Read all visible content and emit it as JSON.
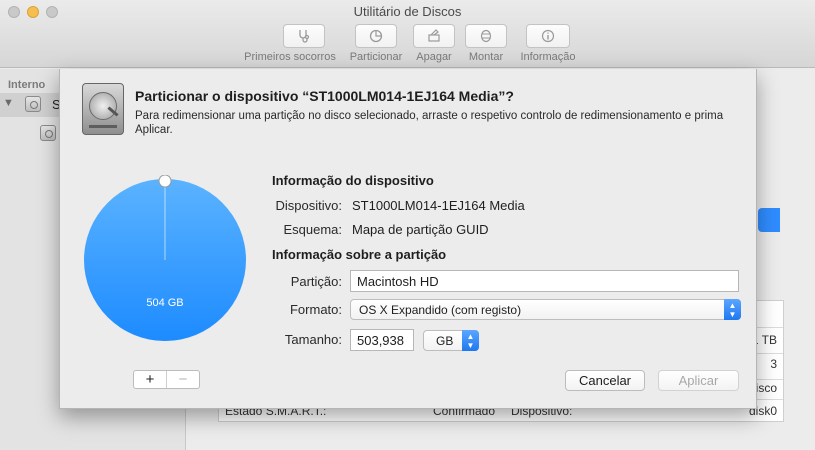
{
  "window": {
    "title": "Utilitário de Discos"
  },
  "toolbar": {
    "buttons": [
      {
        "label": "Primeiros socorros",
        "icon": "stethoscope-icon"
      },
      {
        "label": "Particionar",
        "icon": "partition-icon"
      },
      {
        "label": "Apagar",
        "icon": "erase-icon"
      },
      {
        "label": "Montar",
        "icon": "mount-icon"
      },
      {
        "label": "Informação",
        "icon": "info-icon"
      }
    ]
  },
  "sidebar": {
    "header": "Interno",
    "disk_label_fragment": "S"
  },
  "background_table": {
    "row1_right": "1 TB",
    "row2_right": "3",
    "row3_right": "isco",
    "smart_label": "Estado S.M.A.R.T.:",
    "smart_value": "Confirmado",
    "device_label": "Dispositivo:",
    "device_value": "disk0"
  },
  "dialog": {
    "title": "Particionar o dispositivo “ST1000LM014-1EJ164 Media”?",
    "description": "Para redimensionar uma partição no disco selecionado, arraste o respetivo controlo de redimensionamento e prima Aplicar.",
    "pie": {
      "label": "504 GB",
      "color": "#2f96ff"
    },
    "device_info": {
      "heading": "Informação do dispositivo",
      "device_label": "Dispositivo:",
      "device_value": "ST1000LM014-1EJ164 Media",
      "scheme_label": "Esquema:",
      "scheme_value": "Mapa de partição GUID"
    },
    "partition_info": {
      "heading": "Informação sobre a partição",
      "partition_label": "Partição:",
      "partition_value": "Macintosh HD",
      "format_label": "Formato:",
      "format_value": "OS X Expandido (com registo)",
      "size_label": "Tamanho:",
      "size_value": "503,938",
      "unit_value": "GB"
    },
    "segment": {
      "add": "+",
      "remove": "−"
    },
    "buttons": {
      "cancel": "Cancelar",
      "apply": "Aplicar"
    }
  }
}
